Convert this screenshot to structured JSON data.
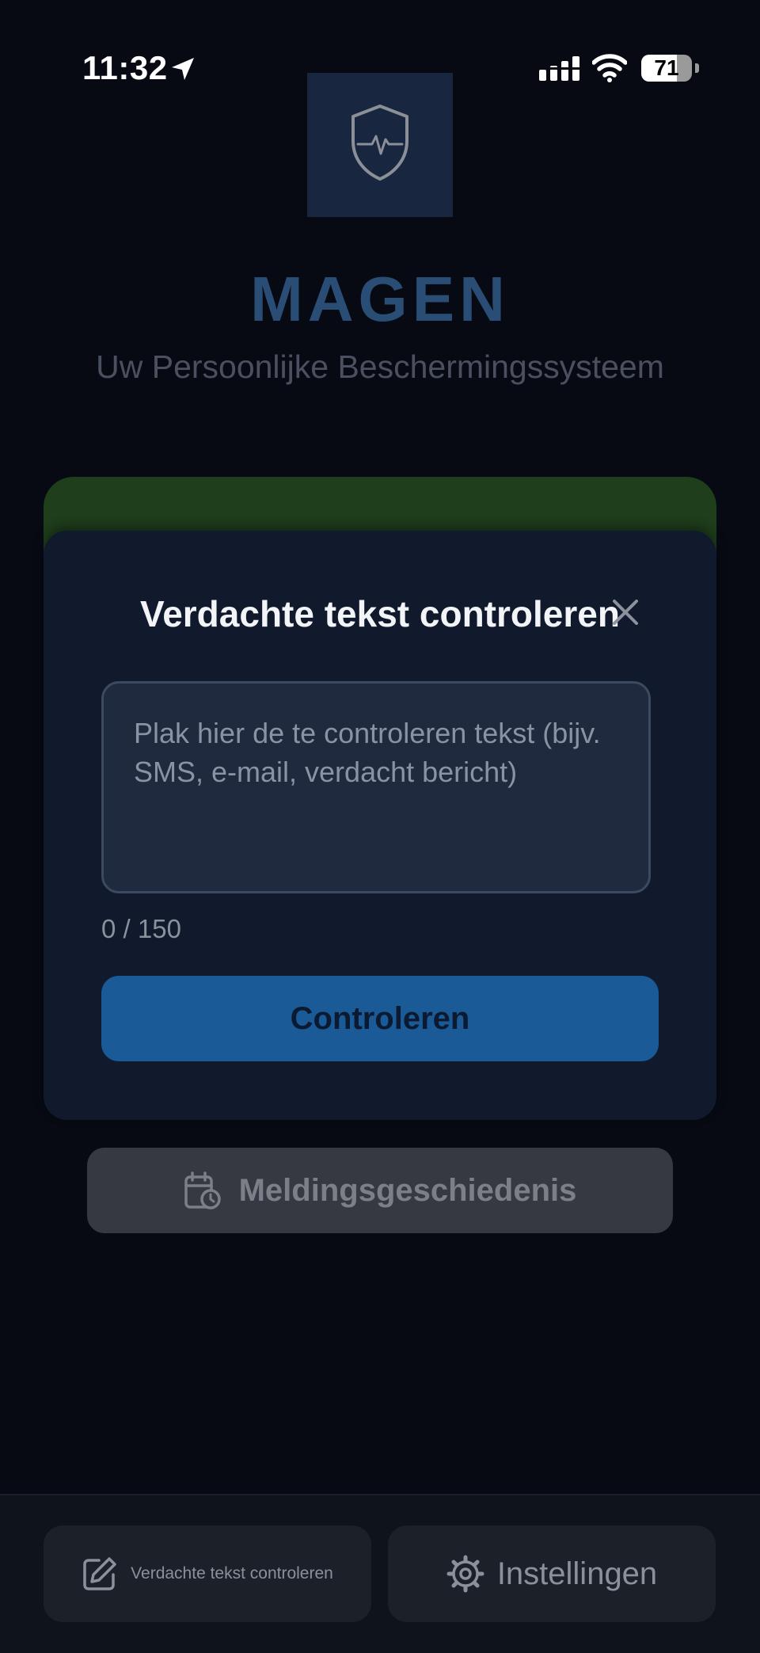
{
  "status_bar": {
    "time": "11:32",
    "battery_percent": 71,
    "battery_label": "71",
    "icons": [
      "location-arrow-icon",
      "cellular-signal-icon",
      "wifi-icon",
      "battery-icon"
    ]
  },
  "app": {
    "logo_icon": "shield-heartbeat-icon",
    "title": "MAGEN",
    "subtitle": "Uw Persoonlijke Beschermingssysteem"
  },
  "modal": {
    "title": "Verdachte tekst controleren",
    "close_icon": "close-icon",
    "input_value": "",
    "input_placeholder": "Plak hier de te controleren tekst (bijv. SMS, e-mail, verdacht bericht)",
    "counter": "0 / 150",
    "submit_label": "Controleren"
  },
  "history_button": {
    "icon": "calendar-clock-icon",
    "label": "Meldingsgeschiedenis"
  },
  "bottom_nav": {
    "check_text": {
      "icon": "edit-icon",
      "label": "Verdachte tekst controleren"
    },
    "settings": {
      "icon": "gear-icon",
      "label": "Instellingen"
    }
  },
  "colors": {
    "background": "#070a13",
    "accent": "#1a5b97",
    "title": "#2a4d76",
    "status_green": "#1e3e1c",
    "modal": "#111a2c"
  }
}
